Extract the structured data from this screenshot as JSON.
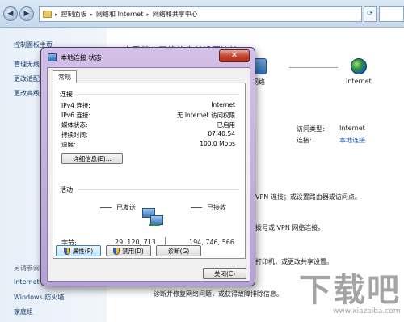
{
  "breadcrumbs": [
    "控制面板",
    "网络和 Internet",
    "网络和共享中心"
  ],
  "left_pane": {
    "links": [
      "控制面板主页",
      "管理无线",
      "更改适配",
      "更改高级"
    ],
    "see_also_label": "另请参阅",
    "see_also_links": [
      "Internet",
      "Windows 防火墙",
      "家庭组"
    ]
  },
  "content": {
    "heading": "查看基本网络信息并设置连接",
    "network_label": "网络",
    "internet_label": "Internet",
    "access_type_label": "访问类型:",
    "access_type_value": "Internet",
    "connection_label": "连接:",
    "connection_value": "本地连接",
    "para1": "VPN 连接；或设置路由器或访问点。",
    "para2": "拨号或 VPN 网络连接。",
    "para3": "打印机，或更改共享设置。",
    "para4": "诊断并修复网络问题，或获得故障排除信息。"
  },
  "dialog": {
    "title": "本地连接 状态",
    "close_glyph": "✕",
    "tab_general": "常规",
    "connection_group": "连接",
    "rows": [
      {
        "label": "IPv4 连接:",
        "value": "Internet"
      },
      {
        "label": "IPv6 连接:",
        "value": "无 Internet 访问权限"
      },
      {
        "label": "媒体状态:",
        "value": "已启用"
      },
      {
        "label": "持续时间:",
        "value": "07:40:54"
      },
      {
        "label": "速度:",
        "value": "100.0 Mbps"
      }
    ],
    "details_button": "详细信息(E)...",
    "activity_group": "活动",
    "sent_label": "已发送",
    "received_label": "已接收",
    "bytes_label": "字节:",
    "bytes_sent": "29, 120, 713",
    "bytes_received": "194, 746, 566",
    "properties_button": "属性(P)",
    "disable_button": "禁用(D)",
    "diagnose_button": "诊断(G)",
    "close_button": "关闭(C)"
  },
  "watermark": {
    "text": "下载吧",
    "sub": "www.xiazaiba.com"
  }
}
